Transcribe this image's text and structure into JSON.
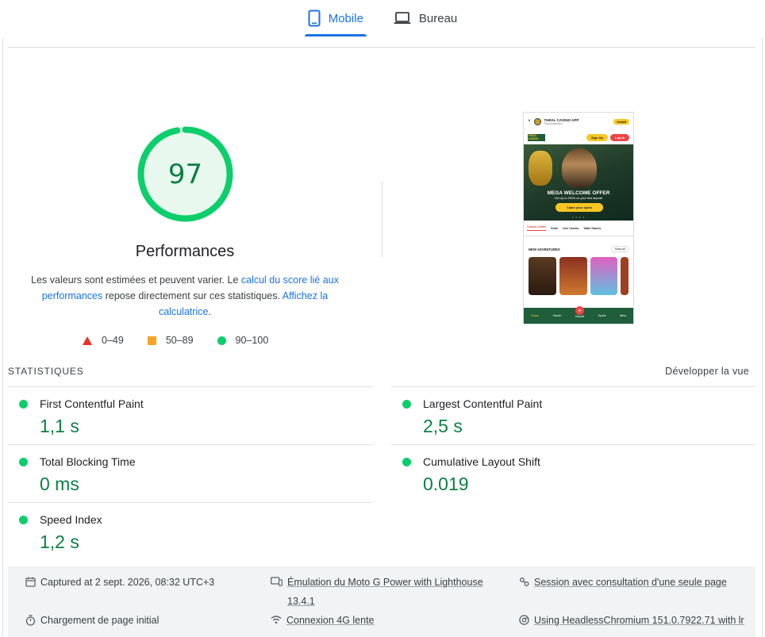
{
  "tabs": [
    {
      "label": "Mobile",
      "icon": "phone-icon",
      "active": true
    },
    {
      "label": "Bureau",
      "icon": "laptop-icon",
      "active": false
    }
  ],
  "score": {
    "value": "97",
    "fraction": 0.97,
    "title": "Performances",
    "desc_part1": "Les valeurs sont estimées et peuvent varier. Le ",
    "desc_link1": "calcul du score lié aux performances",
    "desc_part2": " repose directement sur ces statistiques. ",
    "desc_link2": "Affichez la calculatrice",
    "desc_part3": ".",
    "color": "#0cce6b"
  },
  "legend": [
    {
      "label": "0–49",
      "shape": "triangle",
      "color": "#ea3323"
    },
    {
      "label": "50–89",
      "shape": "square",
      "color": "#f4a425"
    },
    {
      "label": "90–100",
      "shape": "circle",
      "color": "#0cce6b"
    }
  ],
  "thumbnail": {
    "app_name": "THEAL CASINO APP",
    "app_sub": "Play Anywhere",
    "install": "Install",
    "brand": "THEAL CASINO",
    "sign_up": "Sign Up",
    "log_in": "Log In",
    "offer": "MEGA WELCOME OFFER",
    "offer_sub": "Get up to 250% on your first deposit",
    "claim": "Claim your spins",
    "dots": "• • • •",
    "tabs": [
      "Casino Online",
      "Slots",
      "Live Casino",
      "Table Games"
    ],
    "section": "NEW ADVENTURES",
    "show_all": "Show all",
    "bottom_nav": [
      "Casino",
      "Search",
      "Deposit",
      "Sports",
      "Menu"
    ]
  },
  "stats": {
    "heading": "STATISTIQUES",
    "expand_label": "Développer la vue",
    "metrics": [
      {
        "name": "First Contentful Paint",
        "value": "1,1 s"
      },
      {
        "name": "Largest Contentful Paint",
        "value": "2,5 s"
      },
      {
        "name": "Total Blocking Time",
        "value": "0 ms"
      },
      {
        "name": "Cumulative Layout Shift",
        "value": "0.019"
      },
      {
        "name": "Speed Index",
        "value": "1,2 s"
      }
    ]
  },
  "footer": {
    "captured": "Captured at 2 sept. 2026, 08:32 UTC+3",
    "emulation_1": "Émulation du Moto G Power with Lighthouse",
    "emulation_2": "13.4.1",
    "session": "Session avec consultation d'une seule page",
    "load": "Chargement de page initial",
    "network": "Connexion 4G lente",
    "browser": "Using HeadlessChromium 151.0.7922.71 with lr"
  }
}
